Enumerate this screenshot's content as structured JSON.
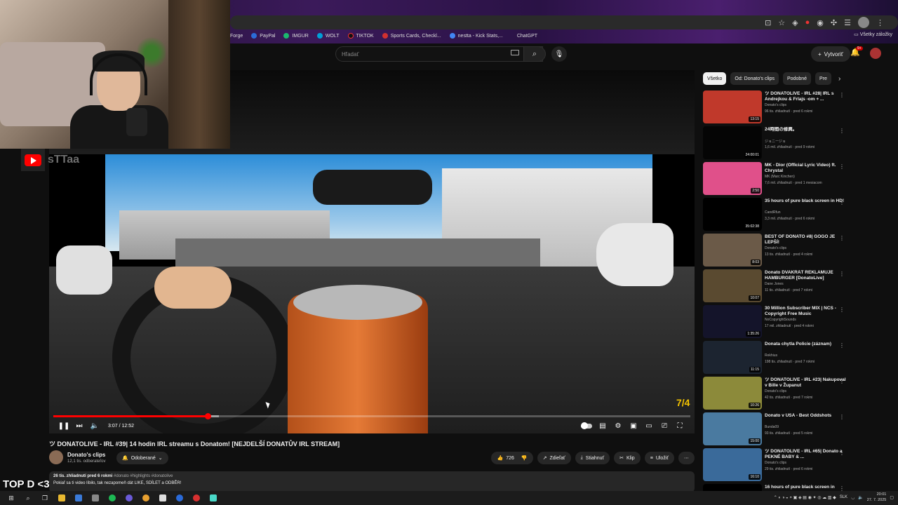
{
  "browser": {
    "bookmarks": [
      "Forge",
      "PayPal",
      "IMGUR",
      "WOLT",
      "TIKTOK",
      "Sports Cards, Checkl...",
      "nestta - Kick Stats,...",
      "ChatGPT"
    ],
    "all_bookmarks": "Všetky záložky"
  },
  "header": {
    "search_placeholder": "Hľadať",
    "create_label": "Vytvoriť",
    "notif_badge": "9+"
  },
  "overlay": {
    "logo_text": "sTTaa",
    "bottom_text": "TOP D <3"
  },
  "player": {
    "current_time": "3:07",
    "duration": "12:52",
    "time_display": "3:07 / 12:52",
    "progress_fraction": 0.242,
    "buffer_fraction": 0.26,
    "corner_watermark": "7/4"
  },
  "video": {
    "title": "ツ DONATOLIVE - IRL #39| 14 hodin IRL streamu s Donatom! [NEJDELŠÍ DONATŮV IRL STREAM]",
    "channel": "Donato's clips",
    "subscribers": "12,1 tis. odberateľov",
    "subscribed_label": "Odoberané",
    "likes": "726",
    "share": "Zdieľať",
    "download": "Stiahnuť",
    "clip": "Klip",
    "save": "Uložiť",
    "views_date": "26 tis. zhliadnutí  pred 6 rokmi",
    "tags": "#donato #highlights #donatolive",
    "description": "Pokiaľ sa ti video líbilo, tak nezapomeň dát LIKE, SDÍLET a ODBĚR!"
  },
  "chips": [
    "Všetko",
    "Od: Donato's clips",
    "Podobné",
    "Pre"
  ],
  "recommendations": [
    {
      "title": "ツ DONATOLIVE - IRL #28| IRL s Andrejkou & Frlajs -om + ...",
      "channel": "Donato's clips",
      "meta": "96 tis. zhliadnutí · pred 6 rokmi",
      "duration": "13:15",
      "color": "#c0392b"
    },
    {
      "title": "24時間の修興。",
      "channel": "ジョニージョ",
      "meta": "1,6 mil. zhliadnutí · pred 9 rokmi",
      "duration": "24:00:01",
      "color": "#050505"
    },
    {
      "title": "MK - Dior (Official Lyric Video) ft. Chrystal",
      "channel": "MK (Marc Kinchen)",
      "meta": "7,6 mil. zhliadnutí · pred 1 mesiacom",
      "duration": "2:50",
      "color": "#e0508a"
    },
    {
      "title": "35 hours of pure black screen in HD!",
      "channel": "CandRfun",
      "meta": "3,3 mil. zhliadnutí · pred 6 rokmi",
      "duration": "35:02:38",
      "color": "#000000"
    },
    {
      "title": "BEST OF DONATO #8| GOGO JE LEPŠÍ!",
      "channel": "Donato's clips",
      "meta": "13 tis. zhliadnutí · pred 4 rokmi",
      "duration": "8:03",
      "color": "#6b5a48"
    },
    {
      "title": "Donato DVAKRÁT REKLAMUJE HAMBURGER [DonatoLive]",
      "channel": "Dane Jones",
      "meta": "11 tis. zhliadnutí · pred 7 rokmi",
      "duration": "10:07",
      "color": "#5a4a30"
    },
    {
      "title": "30 Million Subscriber MIX | NCS - Copyright Free Music",
      "channel": "NoCopyrightSounds",
      "meta": "17 mil. zhliadnutí · pred 4 rokmi",
      "duration": "1:35:26",
      "color": "#14142a"
    },
    {
      "title": "Donata chytla Policie (záznam)",
      "channel": "Rekhius",
      "meta": "198 tis. zhliadnutí · pred 7 rokmi",
      "duration": "11:15",
      "color": "#1c2430"
    },
    {
      "title": "ツ DONATOLIVE - IRL #23| Nakupoval v Bille v Županut",
      "channel": "Donato's clips",
      "meta": "42 tis. zhliadnutí · pred 7 rokmi",
      "duration": "10:26",
      "color": "#8c8a3a"
    },
    {
      "title": "Donato v USA - Best Oddshots",
      "channel": "Bunda09",
      "meta": "93 tis. zhliadnutí · pred 5 rokmi",
      "duration": "15:00",
      "color": "#4a7aa0"
    },
    {
      "title": "ツ DONATOLIVE - IRL #65| Donato a PEKNÉ BABY & ...",
      "channel": "Donato's clips",
      "meta": "29 tis. zhliadnutí · pred 6 rokmi",
      "duration": "16:10",
      "color": "#3a6a9a"
    },
    {
      "title": "16 hours of pure black screen in",
      "channel": "",
      "meta": "",
      "duration": "",
      "color": "#000000"
    }
  ],
  "taskbar": {
    "lang": "SLK",
    "time": "20:01",
    "date": "27. 7. 2025"
  }
}
